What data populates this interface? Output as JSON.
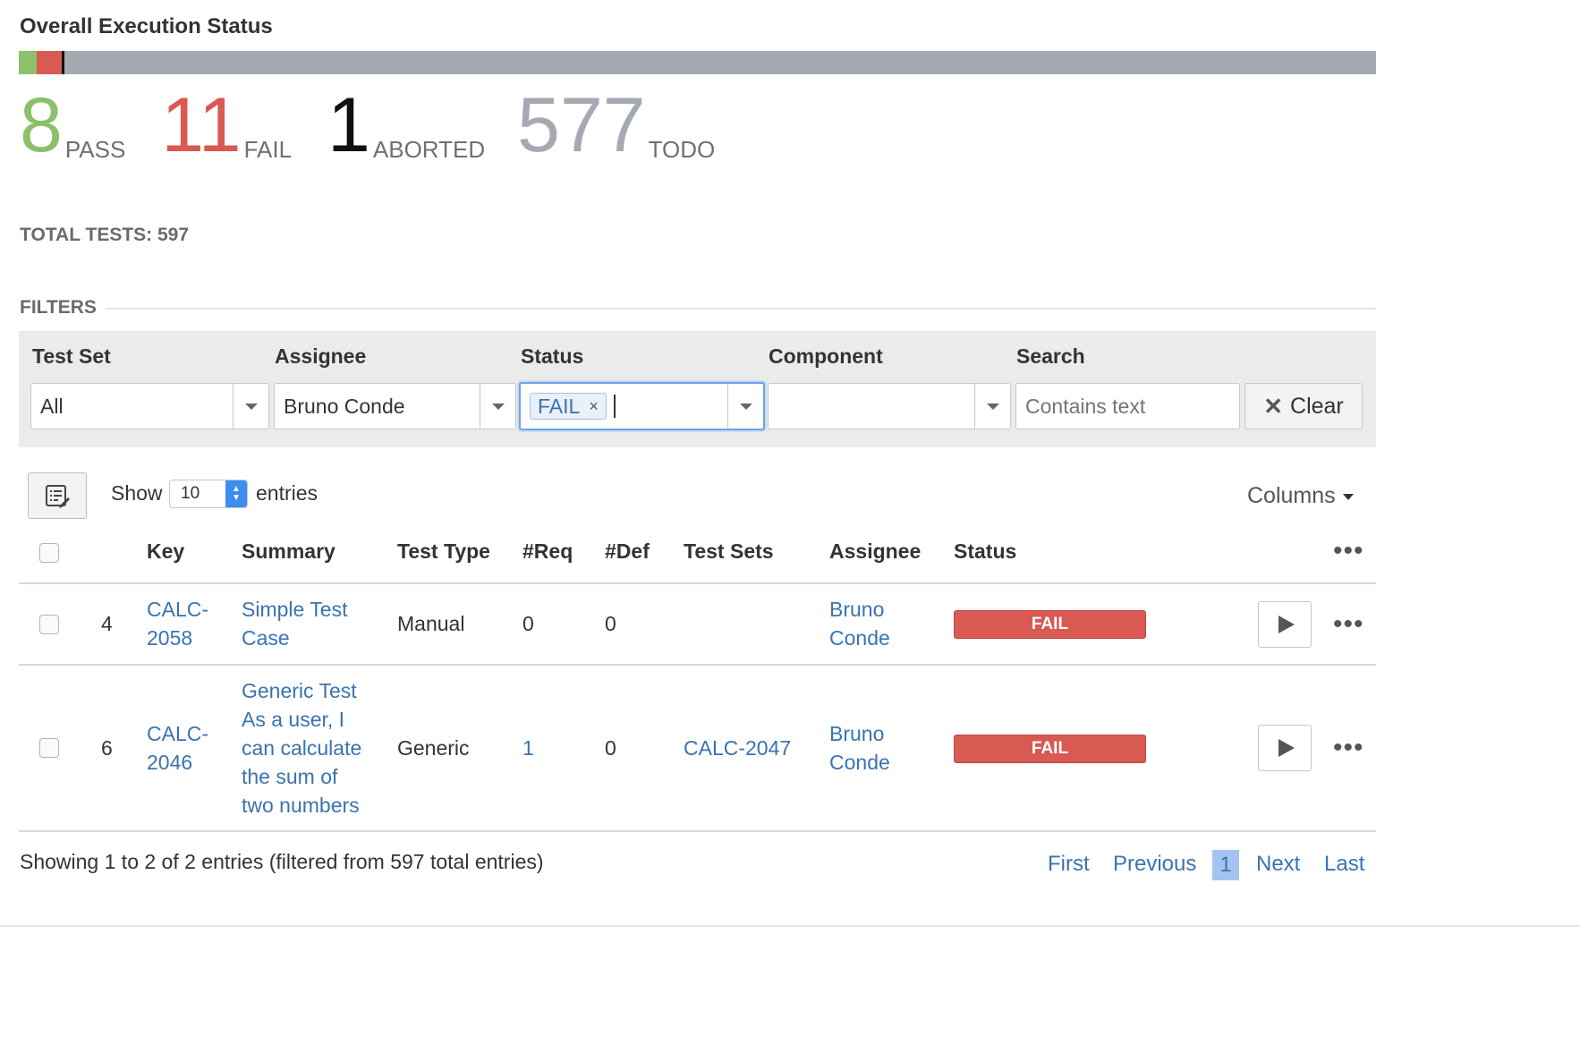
{
  "header": {
    "title": "Overall Execution Status"
  },
  "progress": {
    "total": 597,
    "segments": [
      {
        "name": "PASS",
        "value": 8,
        "color": "#8cc06b"
      },
      {
        "name": "FAIL",
        "value": 11,
        "color": "#d85a52"
      },
      {
        "name": "ABORTED",
        "value": 1,
        "color": "#111111"
      },
      {
        "name": "TODO",
        "value": 577,
        "color": "#a5a9b1"
      }
    ]
  },
  "counts": [
    {
      "number": "8",
      "label": "PASS",
      "color": "#8cc06b"
    },
    {
      "number": "11",
      "label": "FAIL",
      "color": "#d85a52"
    },
    {
      "number": "1",
      "label": "ABORTED",
      "color": "#111111"
    },
    {
      "number": "577",
      "label": "TODO",
      "color": "#a5a9b1"
    }
  ],
  "total_tests": "TOTAL TESTS: 597",
  "filters": {
    "title": "FILTERS",
    "test_set": {
      "label": "Test Set",
      "value": "All"
    },
    "assignee": {
      "label": "Assignee",
      "value": "Bruno Conde"
    },
    "status": {
      "label": "Status",
      "tag": "FAIL",
      "tag_remove": "×"
    },
    "component": {
      "label": "Component",
      "value": ""
    },
    "search": {
      "label": "Search",
      "placeholder": "Contains text"
    },
    "clear_label": "Clear"
  },
  "table_controls": {
    "show_label": "Show",
    "page_size": "10",
    "entries_label": "entries",
    "columns_label": "Columns"
  },
  "table": {
    "headers": [
      "Key",
      "Summary",
      "Test Type",
      "#Req",
      "#Def",
      "Test Sets",
      "Assignee",
      "Status"
    ],
    "rows": [
      {
        "rank": "4",
        "key_line1": "CALC-",
        "key_line2": "2058",
        "summary_lines": [
          "Simple Test",
          "Case"
        ],
        "test_type": "Manual",
        "req": "0",
        "def": "0",
        "test_sets": "",
        "assignee_line1": "Bruno",
        "assignee_line2": "Conde",
        "status": "FAIL"
      },
      {
        "rank": "6",
        "key_line1": "CALC-",
        "key_line2": "2046",
        "summary_lines": [
          "Generic Test",
          "As a user, I",
          "can calculate",
          "the sum of",
          "two numbers"
        ],
        "test_type": "Generic",
        "req": "1",
        "def": "0",
        "test_sets": "CALC-2047",
        "assignee_line1": "Bruno",
        "assignee_line2": "Conde",
        "status": "FAIL"
      }
    ]
  },
  "footer": {
    "showing": "Showing 1 to 2 of 2 entries (filtered from 597 total entries)",
    "first": "First",
    "previous": "Previous",
    "current": "1",
    "next": "Next",
    "last": "Last"
  },
  "icons": {
    "remove": "×",
    "more": "•••",
    "list_view": "list-edit-icon",
    "play": "play-icon"
  }
}
